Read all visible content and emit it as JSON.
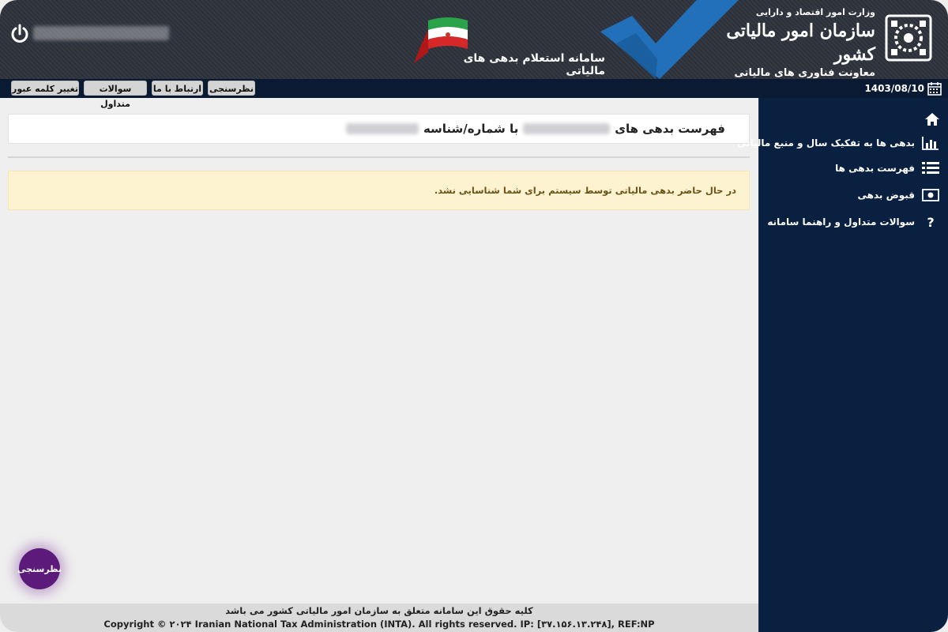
{
  "header": {
    "system_title": "سامانه استعلام بدهی های مالیاتی",
    "org_ministry": "وزارت امور اقتصاد و دارایی",
    "org_name": "سازمان امور مالیاتی کشور",
    "org_deputy": "معاونت فناوری های مالیاتی",
    "icons": [
      "power-icon",
      "flag-icon",
      "checkmark-icon",
      "org-logo"
    ],
    "colors": {
      "bg": "#2c3038",
      "accent": "#1f77c6",
      "toolbar": "#0a1a33",
      "sidebar": "#0a2040"
    }
  },
  "toolbar": {
    "buttons": [
      "تغییر کلمه عبور",
      "سوالات متداول",
      "ارتباط با ما",
      "نظرسنجی"
    ],
    "date": "1403/08/10"
  },
  "sidebar": {
    "items": [
      {
        "label": "بدهی ها به تفکیک سال و منبع مالیاتی",
        "icon": "bar-chart-icon"
      },
      {
        "label": "فهرست بدهی ها",
        "icon": "list-icon"
      },
      {
        "label": "قبوض بدهی",
        "icon": "money-bill-icon"
      },
      {
        "label": "سوالات متداول و راهنما سامانه",
        "icon": "question-icon"
      }
    ]
  },
  "main": {
    "title_prefix": "فهرست بدهی های",
    "title_suffix": "با شماره/شناسه",
    "alert_text": "در حال حاضر بدهی مالیاتی توسط سیستم برای شما شناسایی نشد."
  },
  "survey_bubble": "نظرسنجی",
  "footer": {
    "line1": "کلیه حقوق این سامانه متعلق به سازمان امور مالیاتی کشور می باشد",
    "line2": "Copyright © ۲۰۲۴ Iranian National Tax Administration (INTA). All rights reserved. IP: [۳۷.۱۵۶.۱۳.۲۴۸], REF:NP"
  }
}
